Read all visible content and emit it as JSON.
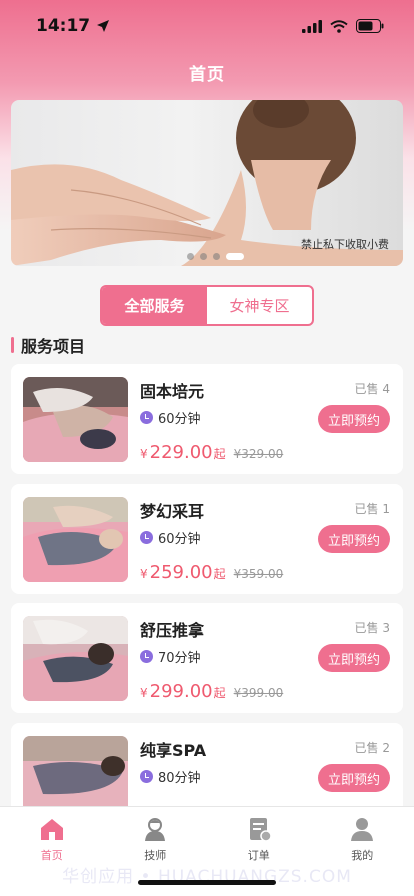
{
  "status_bar": {
    "time": "14:17"
  },
  "nav": {
    "title": "首页"
  },
  "banner": {
    "notice": "禁止私下收取小费",
    "dots": 4,
    "active_dot": 3
  },
  "segment": {
    "tabs": [
      {
        "label": "全部服务",
        "active": true
      },
      {
        "label": "女神专区",
        "active": false
      }
    ]
  },
  "section": {
    "title": "服务项目"
  },
  "services": [
    {
      "name": "固本培元",
      "sold": "已售 4",
      "duration": "60分钟",
      "currency": "¥",
      "price": "229.00",
      "price_suffix": "起",
      "original": "¥329.00",
      "book_label": "立即预约"
    },
    {
      "name": "梦幻采耳",
      "sold": "已售 1",
      "duration": "60分钟",
      "currency": "¥",
      "price": "259.00",
      "price_suffix": "起",
      "original": "¥359.00",
      "book_label": "立即预约"
    },
    {
      "name": "舒压推拿",
      "sold": "已售 3",
      "duration": "70分钟",
      "currency": "¥",
      "price": "299.00",
      "price_suffix": "起",
      "original": "¥399.00",
      "book_label": "立即预约"
    },
    {
      "name": "纯享SPA",
      "sold": "已售 2",
      "duration": "80分钟",
      "currency": "",
      "price": "",
      "price_suffix": "",
      "original": "",
      "book_label": "立即预约"
    }
  ],
  "tabbar": [
    {
      "label": "首页",
      "icon": "home-icon",
      "active": true
    },
    {
      "label": "技师",
      "icon": "therapist-icon",
      "active": false
    },
    {
      "label": "订单",
      "icon": "order-icon",
      "active": false
    },
    {
      "label": "我的",
      "icon": "profile-icon",
      "active": false
    }
  ],
  "watermark": "华创应用 • HUACHUANGZS.COM",
  "colors": {
    "accent": "#ef6f8f",
    "price": "#ef5a6f",
    "clock": "#8a6dde"
  }
}
